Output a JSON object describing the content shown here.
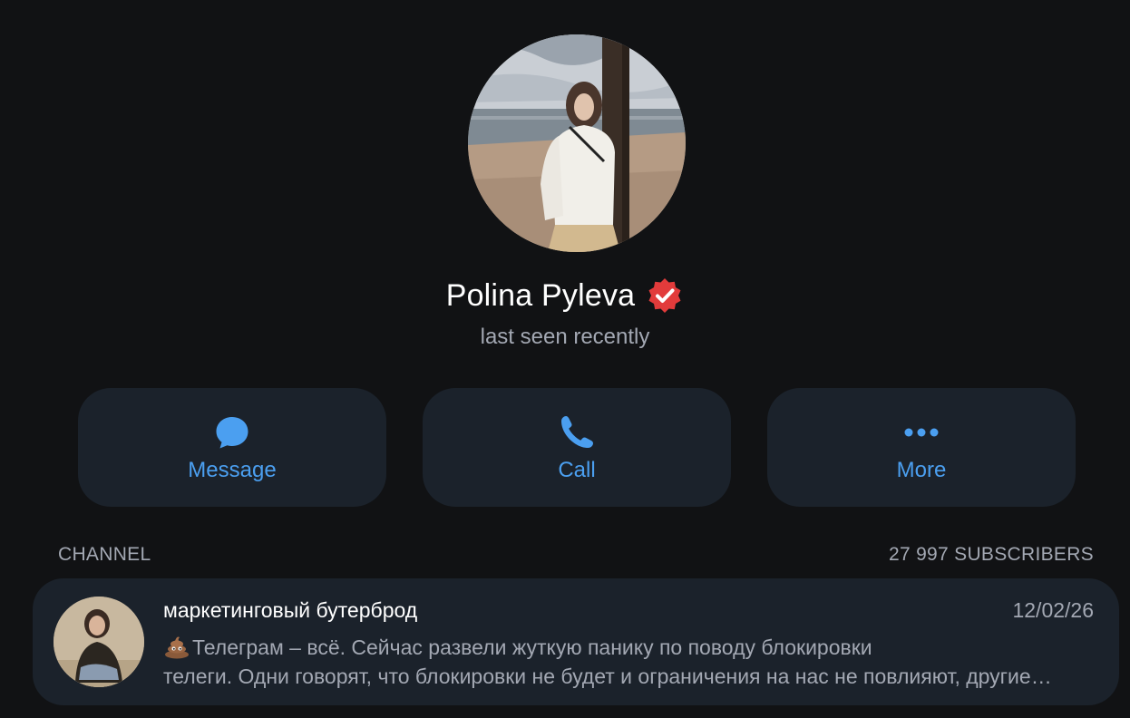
{
  "profile": {
    "name": "Polina Pyleva",
    "status": "last seen recently",
    "verified_icon": "verified-badge-icon",
    "avatar_icon": "profile-photo"
  },
  "actions": [
    {
      "label": "Message",
      "icon": "message-bubble-icon"
    },
    {
      "label": "Call",
      "icon": "phone-icon"
    },
    {
      "label": "More",
      "icon": "more-dots-icon"
    }
  ],
  "section": {
    "title": "CHANNEL",
    "count": "27 997 SUBSCRIBERS"
  },
  "channel": {
    "title": "маркетинговый бутерброд",
    "date": "12/02/26",
    "preview_emoji": "pile-of-poo-icon",
    "preview_line1": "Телеграм – всё.  Сейчас развели жуткую панику по поводу блокировки",
    "preview_line2": "телеги.   Одни говорят, что блокировки не будет и ограничения на нас не повлияют, другие…"
  },
  "colors": {
    "background": "#111214",
    "card": "#1b222b",
    "accent": "#4b9ff0",
    "muted": "#a3a8b3",
    "verified": "#e23b3b"
  }
}
